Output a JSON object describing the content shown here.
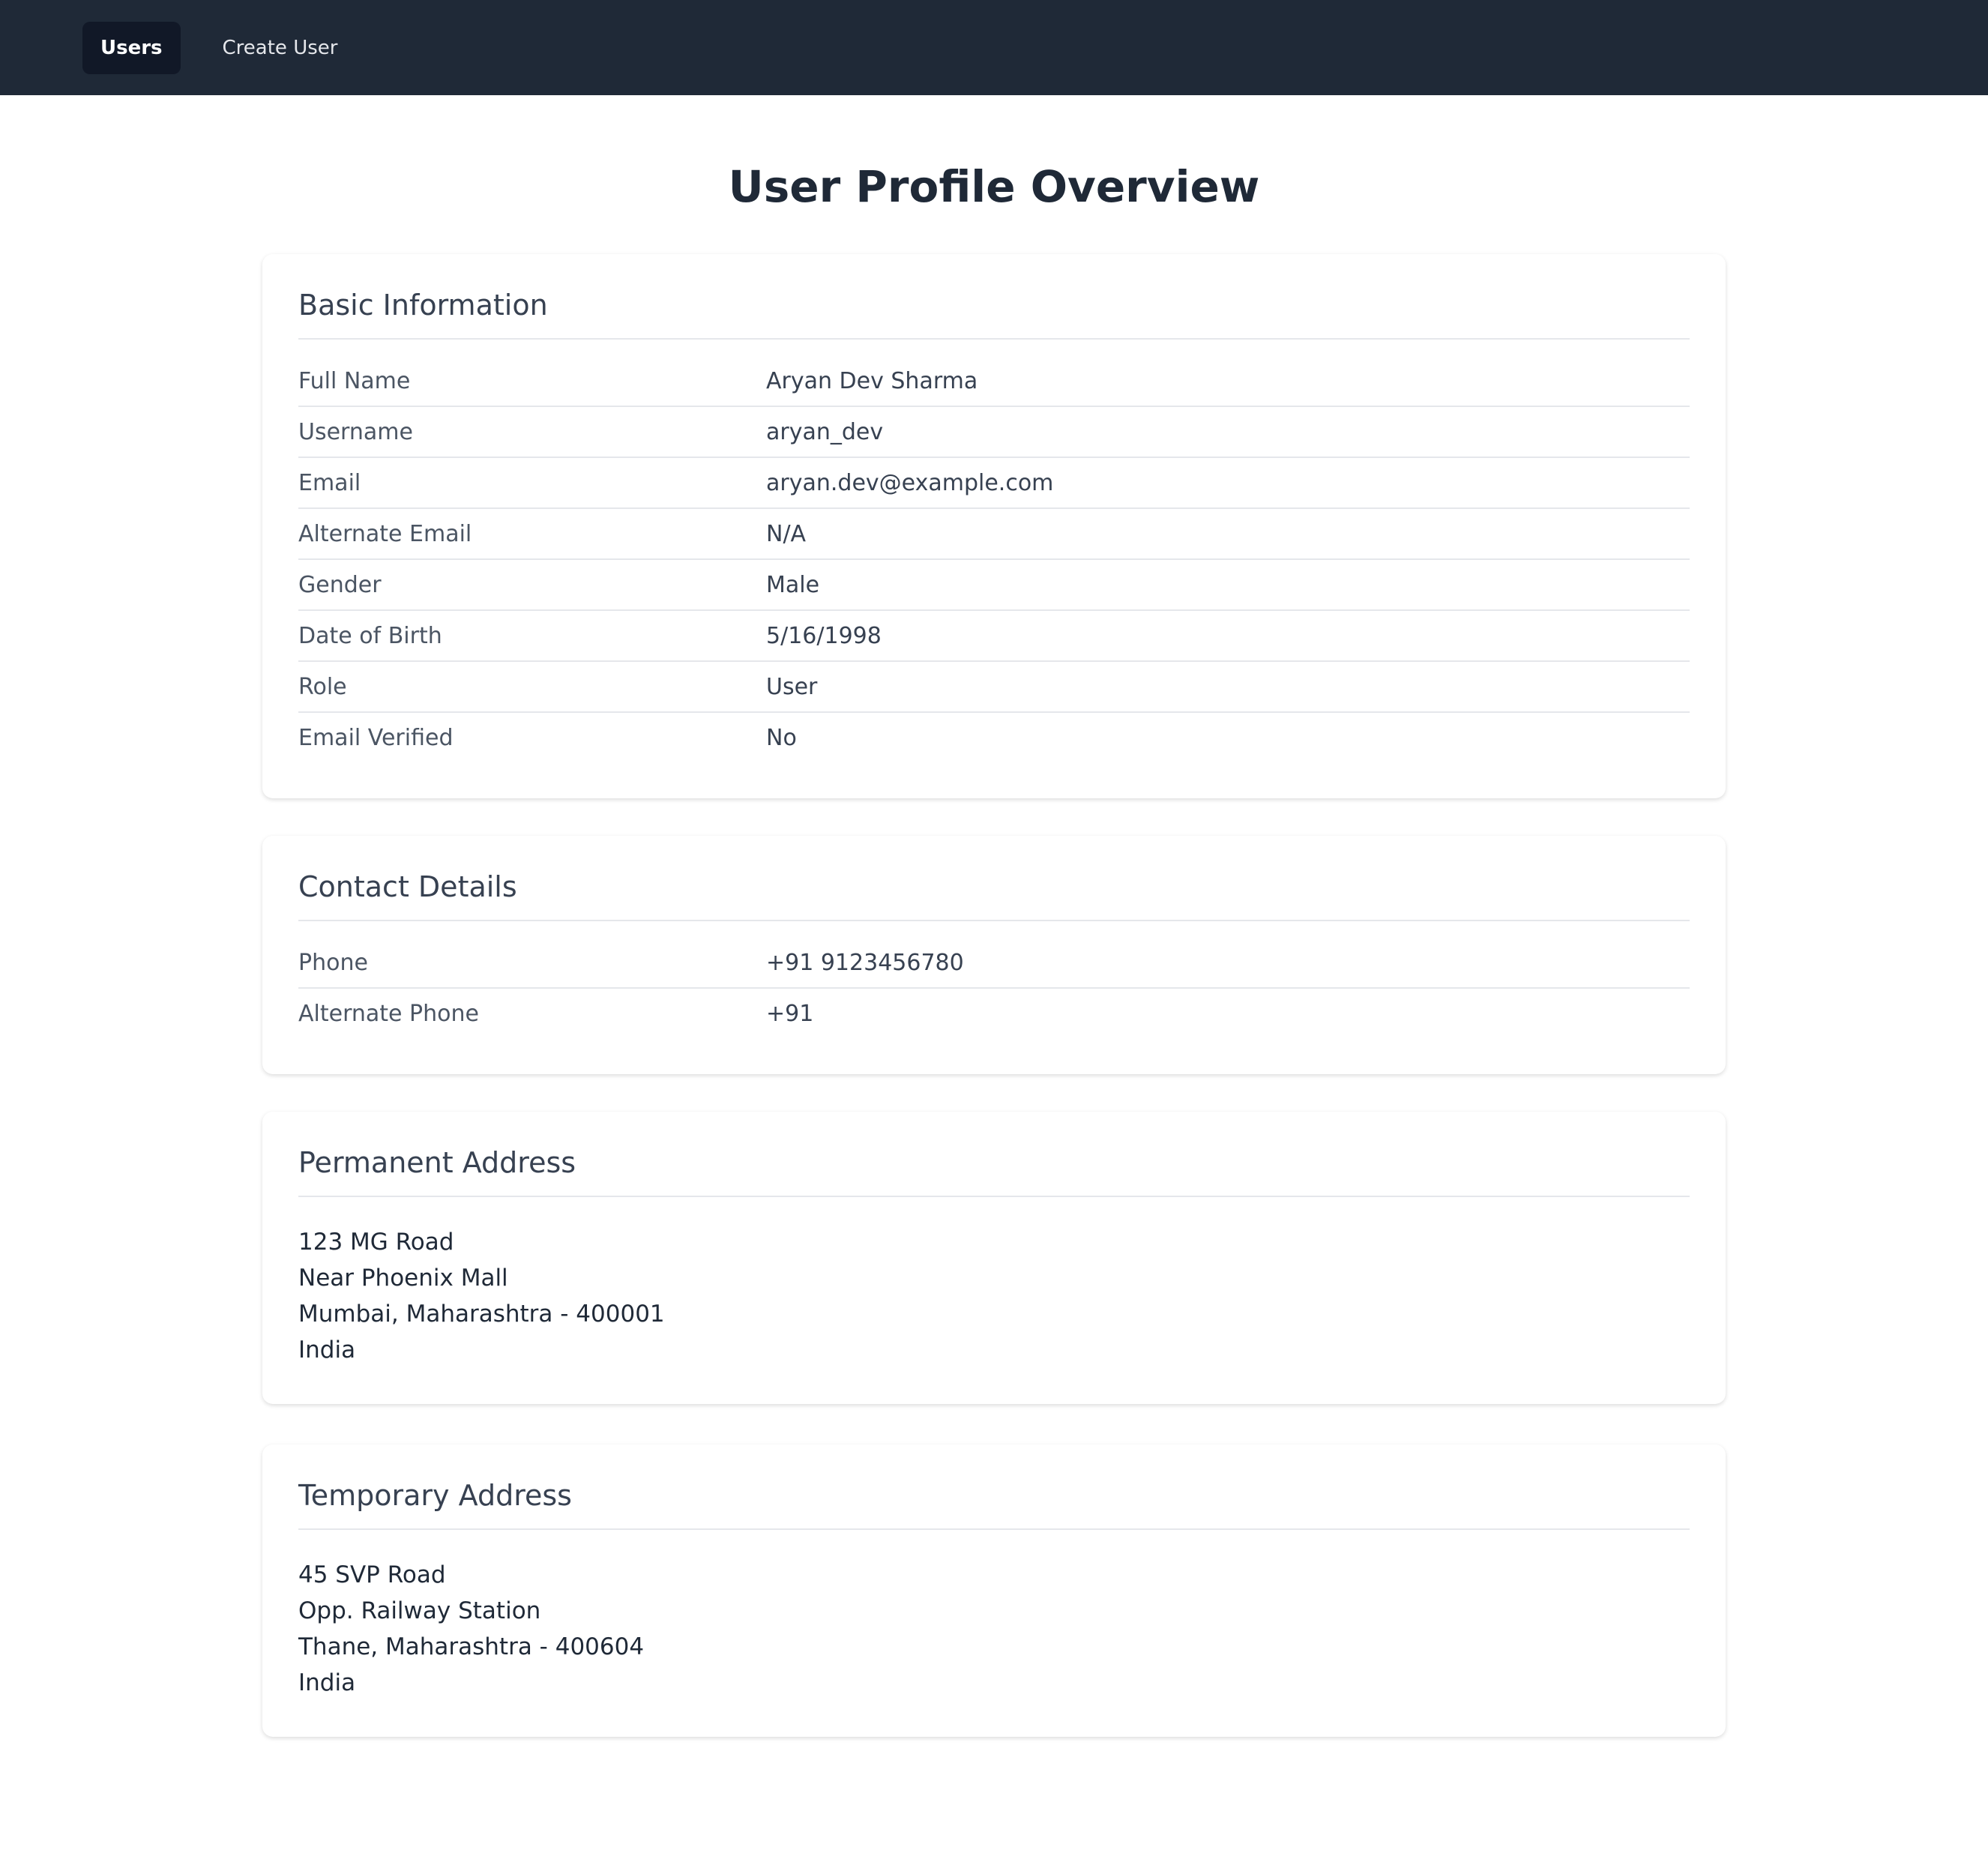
{
  "nav": {
    "users_label": "Users",
    "create_user_label": "Create User"
  },
  "page": {
    "title": "User Profile Overview"
  },
  "basic": {
    "title": "Basic Information",
    "rows": [
      {
        "label": "Full Name",
        "value": "Aryan Dev Sharma"
      },
      {
        "label": "Username",
        "value": "aryan_dev"
      },
      {
        "label": "Email",
        "value": "aryan.dev@example.com"
      },
      {
        "label": "Alternate Email",
        "value": "N/A"
      },
      {
        "label": "Gender",
        "value": "Male"
      },
      {
        "label": "Date of Birth",
        "value": "5/16/1998"
      },
      {
        "label": "Role",
        "value": "User"
      },
      {
        "label": "Email Verified",
        "value": "No"
      }
    ]
  },
  "contact": {
    "title": "Contact Details",
    "rows": [
      {
        "label": "Phone",
        "value": "+91 9123456780"
      },
      {
        "label": "Alternate Phone",
        "value": "+91"
      }
    ]
  },
  "permanent": {
    "title": "Permanent Address",
    "lines": [
      "123 MG Road",
      "Near Phoenix Mall",
      "Mumbai, Maharashtra - 400001",
      "India"
    ]
  },
  "temporary": {
    "title": "Temporary Address",
    "lines": [
      "45 SVP Road",
      "Opp. Railway Station",
      "Thane, Maharashtra - 400604",
      "India"
    ]
  },
  "colors": {
    "navbar_bg": "#1f2937",
    "active_tab_bg": "#111827"
  }
}
